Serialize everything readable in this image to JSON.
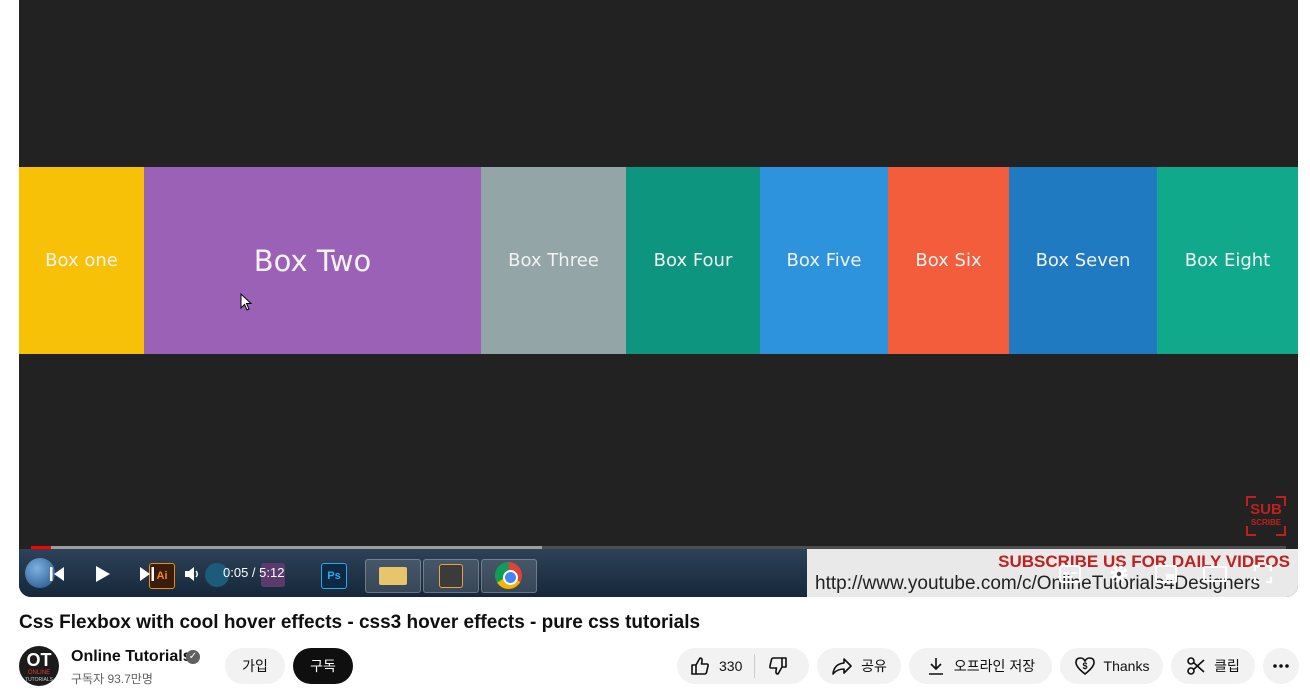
{
  "video": {
    "boxes": [
      {
        "label": "Box one",
        "color": "#f7c107"
      },
      {
        "label": "Box Two",
        "color": "#9b61b7"
      },
      {
        "label": "Box Three",
        "color": "#93a5a6"
      },
      {
        "label": "Box Four",
        "color": "#0e957f"
      },
      {
        "label": "Box Five",
        "color": "#2e93dd"
      },
      {
        "label": "Box Six",
        "color": "#f45d3c"
      },
      {
        "label": "Box Seven",
        "color": "#1f7ac1"
      },
      {
        "label": "Box Eight",
        "color": "#10a98b"
      }
    ],
    "subscribe_logo_top": "SUB",
    "subscribe_logo_bottom": "SCRIBE",
    "banner_line1": "SUBSCRIBE US FOR DAILY VIDEOS",
    "banner_line2": "http://www.youtube.com/c/OnlineTutorials4Designers",
    "taskbar_ps_label": "Ps"
  },
  "player": {
    "time_display": "0:05 / 5:12",
    "played_fraction": 0.016,
    "buffered_fraction": 0.407,
    "accent_color": "#ff0000"
  },
  "title": "Css Flexbox with cool hover effects - css3 hover effects - pure css tutorials",
  "channel": {
    "name": "Online Tutorials",
    "subscribers": "구독자 93.7만명",
    "avatar_text": "OT",
    "avatar_sub1": "ONLINE",
    "avatar_sub2": "TUTORIALS"
  },
  "buttons": {
    "join": "가입",
    "subscribe": "구독",
    "like_count": "330",
    "share": "공유",
    "download": "오프라인 저장",
    "thanks": "Thanks",
    "clip": "클립"
  }
}
